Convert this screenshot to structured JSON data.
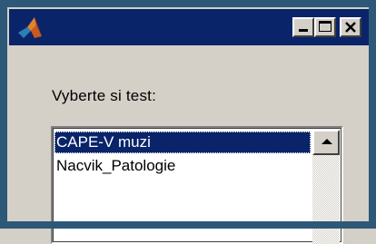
{
  "window": {
    "icon": "matlab-logo-icon",
    "controls": [
      "minimize-icon",
      "maximize-icon",
      "close-icon"
    ]
  },
  "dialog": {
    "prompt": "Vyberte si test:"
  },
  "listbox": {
    "items": [
      "CAPE-V muzi",
      "Nacvik_Patologie"
    ],
    "selected_index": 0
  },
  "colors": {
    "titlebar": "#0a246a",
    "selection": "#0a246a",
    "face": "#d4d0c8"
  }
}
